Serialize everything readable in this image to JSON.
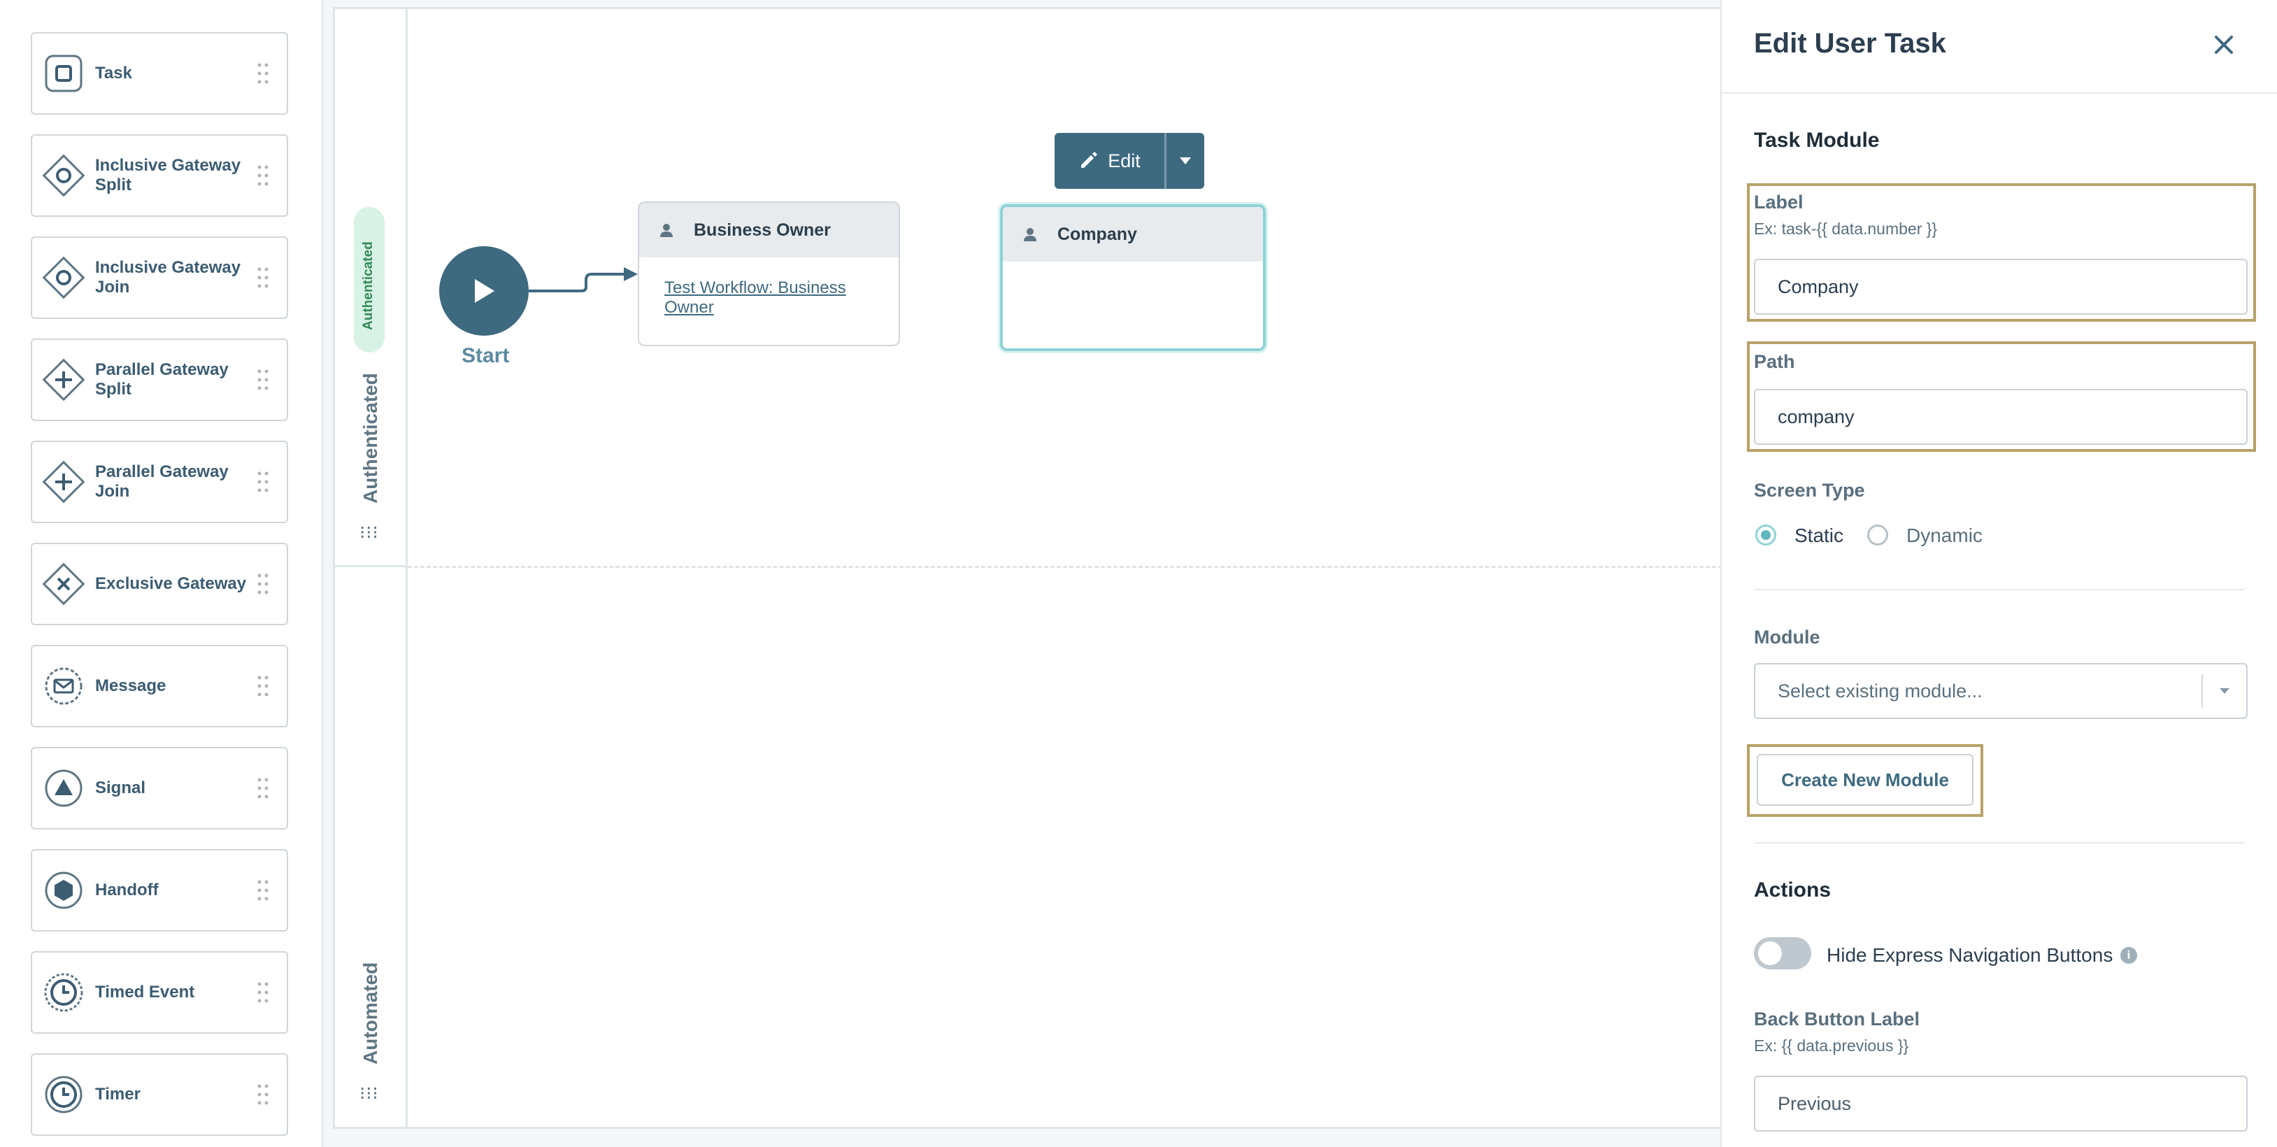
{
  "palette": {
    "items": [
      {
        "label": "Task",
        "icon": "task-icon"
      },
      {
        "label": "Inclusive Gateway Split",
        "icon": "inclusive-gateway-icon"
      },
      {
        "label": "Inclusive Gateway Join",
        "icon": "inclusive-gateway-icon"
      },
      {
        "label": "Parallel Gateway Split",
        "icon": "parallel-gateway-icon"
      },
      {
        "label": "Parallel Gateway Join",
        "icon": "parallel-gateway-icon"
      },
      {
        "label": "Exclusive Gateway",
        "icon": "exclusive-gateway-icon"
      },
      {
        "label": "Message",
        "icon": "message-icon"
      },
      {
        "label": "Signal",
        "icon": "signal-icon"
      },
      {
        "label": "Handoff",
        "icon": "handoff-icon"
      },
      {
        "label": "Timed Event",
        "icon": "timed-event-icon"
      },
      {
        "label": "Timer",
        "icon": "timer-icon"
      }
    ]
  },
  "canvas": {
    "lanes": [
      {
        "label": "Authenticated",
        "badge": "Authenticated"
      },
      {
        "label": "Automated"
      }
    ],
    "start_label": "Start",
    "nodes": {
      "business_owner": {
        "title": "Business Owner",
        "link": "Test Workflow: Business Owner"
      },
      "company": {
        "title": "Company"
      }
    },
    "edit_button": "Edit"
  },
  "panel": {
    "title": "Edit User Task",
    "task_module_title": "Task Module",
    "label_field": {
      "label": "Label",
      "hint": "Ex: task-{{ data.number }}",
      "value": "Company"
    },
    "path_field": {
      "label": "Path",
      "value": "company"
    },
    "screen_type": {
      "label": "Screen Type",
      "options": [
        "Static",
        "Dynamic"
      ],
      "selected": "Static"
    },
    "module": {
      "label": "Module",
      "placeholder": "Select existing module..."
    },
    "create_button": "Create New Module",
    "actions_title": "Actions",
    "hide_nav": {
      "label": "Hide Express Navigation Buttons",
      "enabled": false
    },
    "back_button": {
      "label": "Back Button Label",
      "hint": "Ex: {{ data.previous }}",
      "value": "Previous"
    }
  },
  "colors": {
    "primary": "#3e6a80",
    "highlight": "#b7a26a",
    "selected_border": "#8fd3d6",
    "badge_bg": "#d9f2e6"
  }
}
